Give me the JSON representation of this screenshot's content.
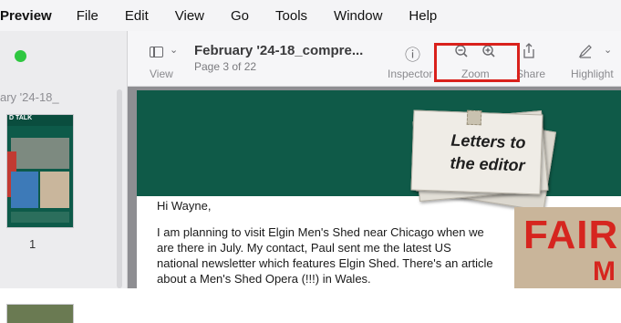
{
  "menubar": {
    "app": "Preview",
    "items": [
      "File",
      "Edit",
      "View",
      "Go",
      "Tools",
      "Window",
      "Help"
    ]
  },
  "toolbar": {
    "view_label": "View",
    "doc_title": "February '24-18_compre...",
    "doc_subtitle": "Page 3 of 22",
    "inspector_label": "Inspector",
    "zoom_label": "Zoom",
    "share_label": "Share",
    "highlight_label": "Highlight"
  },
  "sidebar": {
    "title": "ary '24-18_",
    "thumb_label": "D TALK",
    "page_number": "1"
  },
  "document": {
    "header_text_line1": "Letters to",
    "header_text_line2": "the editor",
    "greeting": "Hi Wayne,",
    "paragraph": "I am planning to visit Elgin Men's Shed near Chicago when we are there in July. My contact, Paul sent me the latest US national newsletter which features Elgin Shed. There's an article about a Men's Shed Opera (!!!) in Wales.",
    "image_text": "FAIR",
    "image_text2": "M"
  },
  "colors": {
    "header_green": "#0f5a48",
    "highlight_red": "#d9211c",
    "traffic_green": "#2fc740"
  }
}
